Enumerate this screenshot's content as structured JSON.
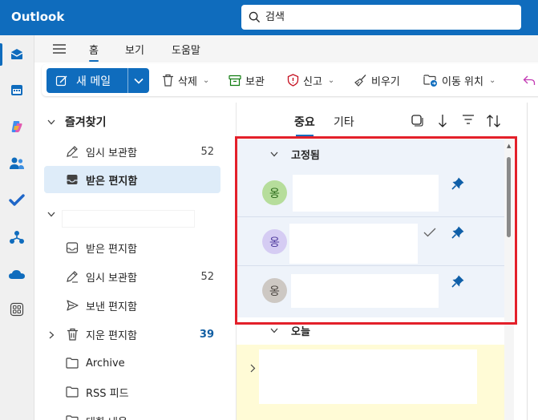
{
  "app": {
    "title": "Outlook"
  },
  "search": {
    "placeholder": "검색"
  },
  "menu": {
    "tabs": [
      {
        "label": "홈"
      },
      {
        "label": "보기"
      },
      {
        "label": "도움말"
      }
    ]
  },
  "ribbon": {
    "new_mail": "새 메일",
    "delete": "삭제",
    "archive": "보관",
    "report": "신고",
    "sweep": "비우기",
    "move_to": "이동 위치"
  },
  "favorites": {
    "title": "즐겨찾기",
    "items": [
      {
        "label": "임시 보관함",
        "count": "52"
      },
      {
        "label": "받은 편지함",
        "count": ""
      }
    ]
  },
  "account": {
    "items": [
      {
        "label": "받은 편지함",
        "count": ""
      },
      {
        "label": "임시 보관함",
        "count": "52"
      },
      {
        "label": "보낸 편지함",
        "count": ""
      },
      {
        "label": "지운 편지함",
        "count": "39"
      },
      {
        "label": "Archive",
        "count": ""
      },
      {
        "label": "RSS 피드",
        "count": ""
      },
      {
        "label": "대화 내용",
        "count": ""
      }
    ]
  },
  "list": {
    "tabs": [
      {
        "label": "중요"
      },
      {
        "label": "기타"
      }
    ],
    "pinned_group": "고정됨",
    "today_group": "오늘",
    "avatar_glyph": "옹"
  },
  "colors": {
    "brand": "#0f6cbd",
    "highlight": "#e3202a",
    "unread_count": "#115ea3"
  },
  "icons": {
    "rail": [
      "mail-icon",
      "calendar-icon",
      "copilot-icon",
      "people-icon",
      "todo-icon",
      "org-icon",
      "onedrive-icon",
      "apps-icon"
    ]
  }
}
